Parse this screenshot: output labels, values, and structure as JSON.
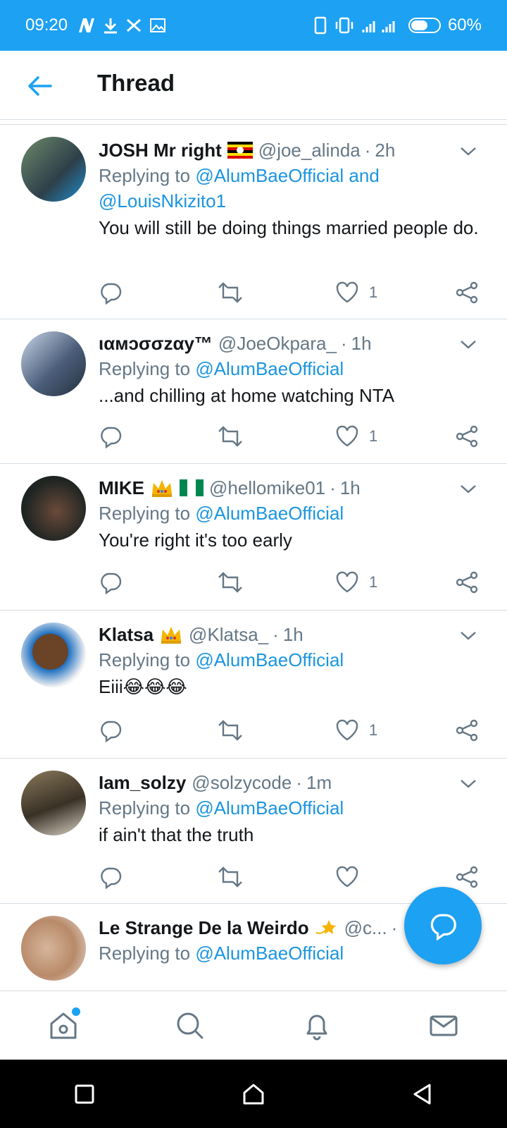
{
  "status_bar": {
    "time": "09:20",
    "battery": "60%"
  },
  "header": {
    "title": "Thread"
  },
  "tweets": [
    {
      "name": "JOSH Mr right",
      "handle": "@joe_alinda",
      "sep": "·",
      "time": "2h",
      "reply_prefix": "Replying to",
      "mentions": "@AlumBaeOfficial and @LouisNkizito1",
      "text": "You will still be doing things married people do.",
      "likes": "1"
    },
    {
      "name": "ιαмɔσσzαy™",
      "handle": "@JoeOkpara_",
      "sep": "·",
      "time": "1h",
      "reply_prefix": "Replying to",
      "mentions": "@AlumBaeOfficial",
      "text": "...and chilling at home watching NTA",
      "likes": "1"
    },
    {
      "name": "MIKE",
      "handle": "@hellomike01",
      "sep": "·",
      "time": "1h",
      "reply_prefix": "Replying to",
      "mentions": "@AlumBaeOfficial",
      "text": "You're right it's too early",
      "likes": "1"
    },
    {
      "name": "Klatsa",
      "handle": "@Klatsa_",
      "sep": "·",
      "time": "1h",
      "reply_prefix": "Replying to",
      "mentions": "@AlumBaeOfficial",
      "text": "Eiii😂😂😂",
      "likes": "1"
    },
    {
      "name": "Iam_solzy",
      "handle": "@solzycode",
      "sep": "·",
      "time": "1m",
      "reply_prefix": "Replying to",
      "mentions": "@AlumBaeOfficial",
      "text": "if ain't that the truth",
      "likes": ""
    },
    {
      "name": "Le Strange De la Weirdo",
      "handle": "@c...",
      "sep": "·",
      "time": "",
      "reply_prefix": "Replying to",
      "mentions": "@AlumBaeOfficial",
      "text": "",
      "likes": ""
    }
  ],
  "colors": {
    "accent": "#1da1f2",
    "link": "#1b95e0",
    "muted": "#657786",
    "text": "#14171a"
  }
}
